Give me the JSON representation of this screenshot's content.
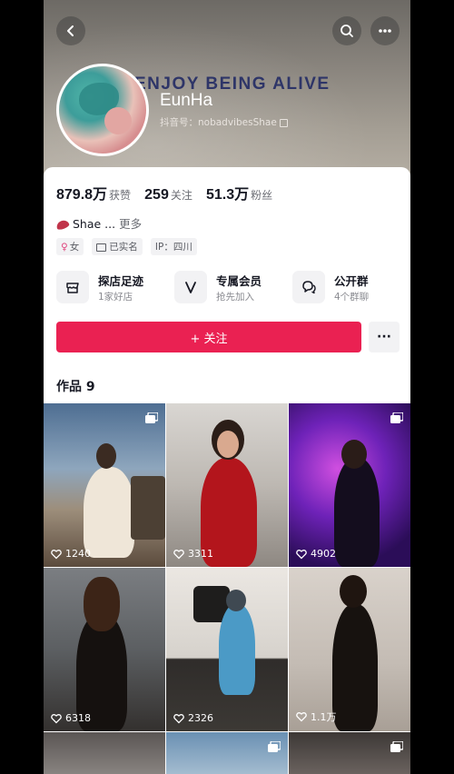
{
  "header": {
    "banner_text": "ENJOY BEING ALIVE",
    "back_icon": "chevron-left-icon",
    "search_icon": "search-icon",
    "menu_icon": "more-dots-icon"
  },
  "profile": {
    "name": "EunHa",
    "handle": "抖音号：nobadvibesShae",
    "stats": [
      {
        "value": "879.8万",
        "label": "获赞"
      },
      {
        "value": "259",
        "label": "关注"
      },
      {
        "value": "51.3万",
        "label": "粉丝"
      }
    ],
    "bio": "Shae ...",
    "bio_more": "更多",
    "tags": [
      {
        "icon": "♀",
        "text": "女"
      },
      {
        "icon": "id",
        "text": "已实名"
      },
      {
        "icon": "",
        "text": "IP：四川"
      }
    ]
  },
  "features": [
    {
      "title": "探店足迹",
      "subtitle": "1家好店",
      "icon": "store-icon"
    },
    {
      "title": "专属会员",
      "subtitle": "抢先加入",
      "icon": "vip-icon"
    },
    {
      "title": "公开群",
      "subtitle": "4个群聊",
      "icon": "group-chat-icon"
    }
  ],
  "actions": {
    "follow_label": "+ 关注",
    "more_label": "···"
  },
  "works": {
    "title": "作品 9",
    "items": [
      {
        "likes": "1240"
      },
      {
        "likes": "3311"
      },
      {
        "likes": "4902"
      },
      {
        "likes": "6318"
      },
      {
        "likes": "2326"
      },
      {
        "likes": "1.1万"
      }
    ]
  },
  "colors": {
    "accent": "#ea2152",
    "banner_text": "#2e3568"
  }
}
